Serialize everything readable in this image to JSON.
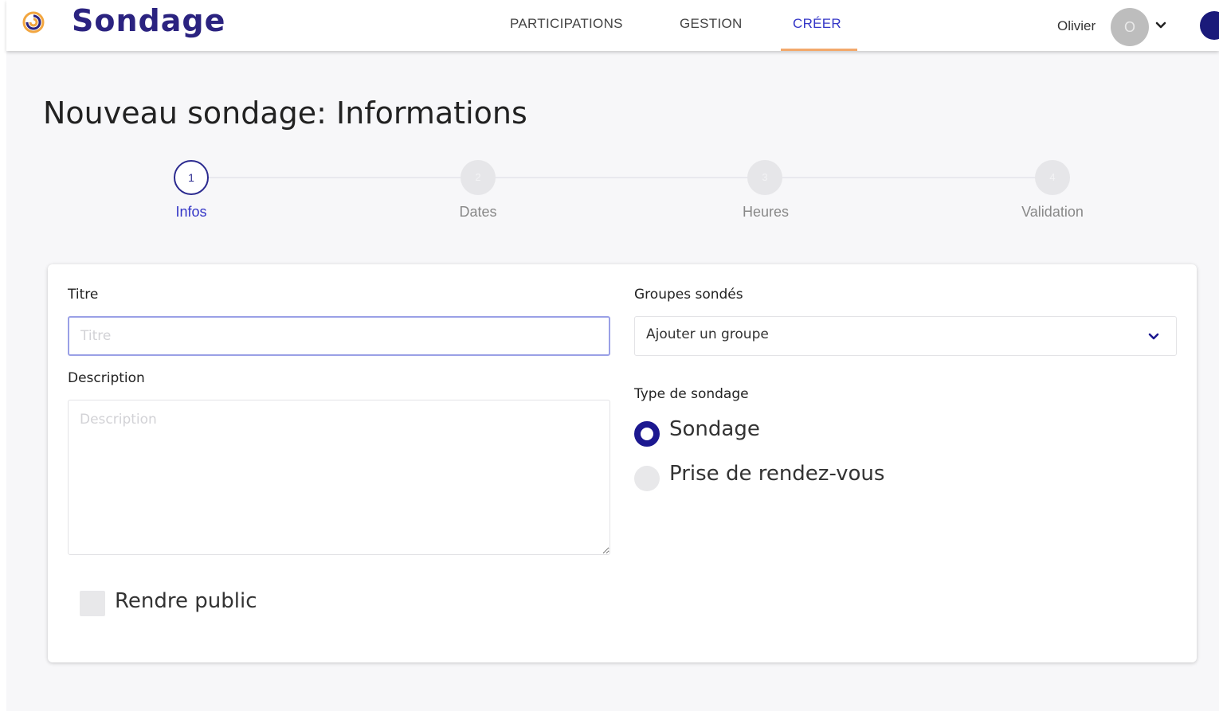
{
  "header": {
    "app_name": "Sondage",
    "nav": [
      {
        "label": "PARTICIPATIONS"
      },
      {
        "label": "GESTION"
      },
      {
        "label": "CRÉER",
        "active": true
      }
    ],
    "user_name": "Olivier",
    "avatar_initial": "O"
  },
  "page": {
    "title": "Nouveau sondage: Informations"
  },
  "stepper": {
    "steps": [
      {
        "number": "1",
        "label": "Infos",
        "active": true
      },
      {
        "number": "2",
        "label": "Dates"
      },
      {
        "number": "3",
        "label": "Heures"
      },
      {
        "number": "4",
        "label": "Validation"
      }
    ]
  },
  "form": {
    "title_label": "Titre",
    "title_placeholder": "Titre",
    "description_label": "Description",
    "description_placeholder": "Description",
    "public_checkbox_label": "Rendre public",
    "groups_label": "Groupes sondés",
    "groups_select_value": "Ajouter un groupe",
    "type_label": "Type de sondage",
    "type_options": [
      {
        "label": "Sondage",
        "checked": true
      },
      {
        "label": "Prise de rendez-vous",
        "checked": false
      }
    ]
  },
  "colors": {
    "brand": "#2b2380",
    "accent": "#3436c7",
    "active_underline": "#f2a86b",
    "radio_checked": "#1c1890"
  }
}
